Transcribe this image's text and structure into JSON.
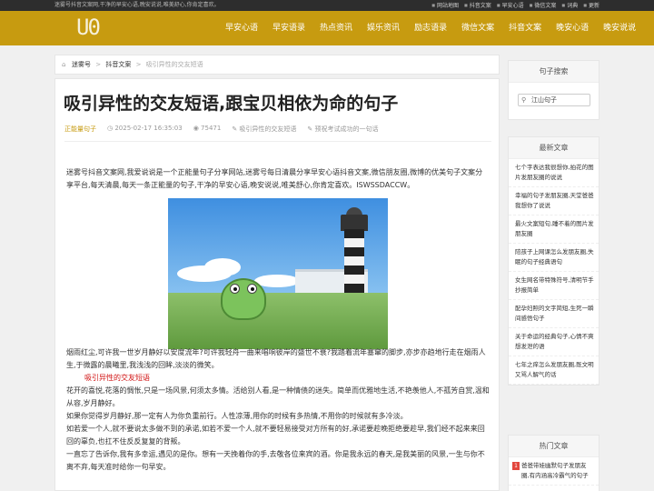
{
  "topbar": {
    "left_text": "迷雾号抖音文案网,干净的早安心语,晚安说说,唯美舒心,你肯定喜欢。",
    "links": [
      "网站地图",
      "抖音文案",
      "早安心语",
      "微信文案",
      "词典",
      "更新"
    ]
  },
  "header": {
    "logo_text": "U0",
    "nav": [
      "早安心语",
      "早安语录",
      "热点资讯",
      "娱乐资讯",
      "励志语录",
      "微信文案",
      "抖音文案",
      "晚安心语",
      "晚安说说"
    ]
  },
  "breadcrumb": {
    "home": "迷雾号",
    "category": "抖音文案",
    "sep": ">",
    "current": "吸引异性的交友短语"
  },
  "article": {
    "title": "吸引异性的交友短语,跟宝贝相依为命的句子",
    "meta": {
      "category": "正能量句子",
      "date": "2025-02-17 16:35:03",
      "views": "75471",
      "tag": "吸引异性的交友短语",
      "related": "预祝考试成功的一句话"
    },
    "intro": "迷雾号抖音文案网,我爱说说是一个正能量句子分享网站,迷雾号每日清晨分享早安心语抖音文案,微信朋友圈,微博的优美句子文案分享平台,每天清晨,每天一条正能量的句子,干净的早安心语,晚安说说,唯美舒心,你肯定喜欢。ISWSSDACCW。",
    "body_first": "烟雨红尘,可许我一世岁月静好以安度流年?可许我轻舟一曲来唱响彼岸的盛世不衰?我踏着流年塞窜的脚步,亦步亦趋地行走在烟雨人生,于微露的晨曦里,我浅浅的回眸,淡淡的微笑。",
    "subhead": "吸引异性的交友短语",
    "paragraphs": [
      "花开的喜悦,花落的惆怅,只是一场风景,何须太多情。活给别人看,是一种情债的迷失。简单而优雅地生活,不艳羡他人,不孤芳自赏,温和从容,岁月静好。",
      "如果你觉得岁月静好,那一定有人为你负重前行。人性凉薄,用你的时候有多热情,不用你的时候就有多冷淡。",
      "如若爱一个人,就不要说太多做不到的承诺,如若不爱一个人,就不要轻易接受对方所有的好,承诺要趁晚拒绝要趁早,我们经不起来来回回的辜负,也扛不住反反复复的背叛。",
      "一直忘了告诉你,我有多幸运,遇见的是你。想有一天挽着你的手,去敬各位来宾的酒。你是我永远的春天,是我美丽的风景,一生与你不离不弃,每天准时给你一句早安。"
    ]
  },
  "sidebar": {
    "search_title": "句子搜索",
    "search_value": "江山句子",
    "latest_title": "最新文章",
    "latest": [
      "七个字表达我很想你,拍花的图片发朋友圈的说说",
      "幸福的句子发朋友圈,天堂爸爸我想你了说说",
      "最火文案短句,睡不着的图片发朋友圈",
      "陪孩子上网课怎么发朋友圈,失眠的句子经典语句",
      "女生网名带特殊符号,清明节手抄报简单",
      "配孕妇照的文字简短,生死一瞬间感悟句子",
      "关于命运的经典句子,心情不爽想发泄的语",
      "七年之痒怎么发朋友圈,既文明又骂人解气的话"
    ],
    "hot_title": "热门文章",
    "hot": [
      {
        "rank": "1",
        "text": "爸爸带娃幽默句子发朋友圈,有内涵高冷霸气的句子"
      }
    ]
  }
}
